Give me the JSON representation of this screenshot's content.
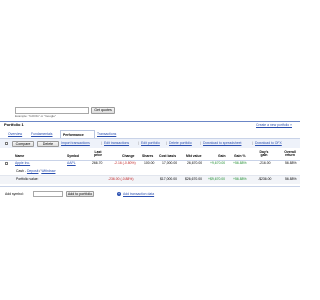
{
  "quote": {
    "input_value": "",
    "button_label": "Get quotes",
    "example": "Example: \"GOOG\" or \"Google\""
  },
  "portfolio": {
    "title": "Portfolio 1",
    "create_link": "Create a new portfolio »"
  },
  "tabs": [
    {
      "label": "Overview"
    },
    {
      "label": "Fundamentals"
    },
    {
      "label": "Performance"
    },
    {
      "label": "Transactions"
    }
  ],
  "toolbar": {
    "compare": "Compare",
    "delete": "Delete",
    "import": "Import transactions",
    "edit_transactions": "Edit transactions",
    "edit_portfolio": "Edit portfolio",
    "delete_portfolio": "Delete portfolio",
    "download_spreadsheet": "Download to spreadsheet",
    "download_ofx": "Download to OFX"
  },
  "table": {
    "headers": {
      "name": "Name",
      "symbol": "Symbol",
      "last_price": "Last price",
      "change": "Change",
      "shares": "Shares",
      "cost_basis": "Cost basis",
      "mkt_value": "Mkt value",
      "gain": "Gain",
      "gain_pct": "Gain %",
      "days_gain": "Day's gain",
      "overall_return": "Overall return"
    },
    "row": {
      "name": "Apple Inc.",
      "symbol": "AAPL",
      "last_price": "266.70",
      "change": "-2.16 (-0.80%)",
      "shares": "100.00",
      "cost_basis": "17,000.00",
      "mkt_value": "26,670.00",
      "gain": "+9,670.00",
      "gain_pct": "+56.88%",
      "days_gain": "-216.00",
      "overall_return": "56.88%"
    },
    "cash": {
      "label": "Cash -",
      "deposit": "Deposit",
      "slash": "/",
      "withdraw": "Withdraw"
    },
    "total": {
      "label": "Portfolio value:",
      "change": "-236.00 (-0.88%)",
      "cost_basis": "$17,000.00",
      "mkt_value": "$26,670.00",
      "gain": "+$9,670.00",
      "gain_pct": "+56.88%",
      "days_gain": "-$236.00",
      "overall_return": "56.88%"
    }
  },
  "add": {
    "label": "Add symbol:",
    "input_value": "",
    "button_label": "Add to portfolio",
    "transaction_link": "Add transaction data"
  }
}
